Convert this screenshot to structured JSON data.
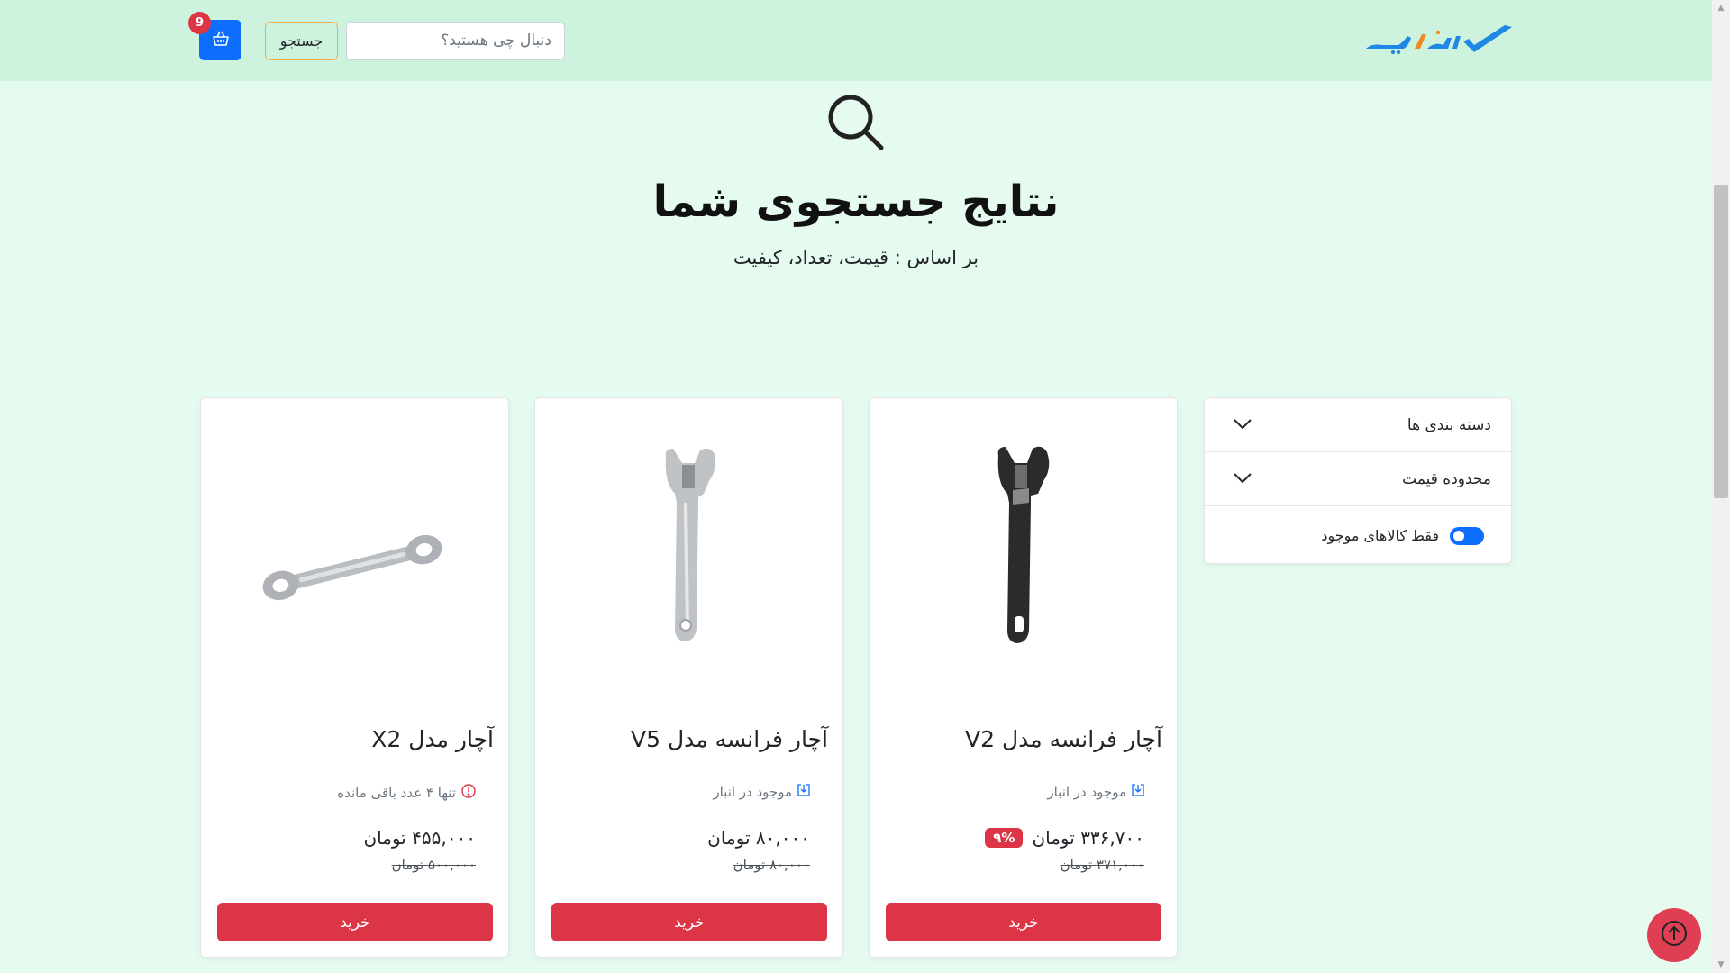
{
  "header": {
    "logo_text": "ابزارچه",
    "search_placeholder": "دنبال چی هستید؟",
    "search_button": "جستجو",
    "cart_count": "9"
  },
  "hero": {
    "title": "نتایج جستجوی شما",
    "subtitle": "بر اساس : قیمت، تعداد، کیفیت"
  },
  "filters": {
    "categories_label": "دسته بندی ها",
    "price_range_label": "محدوده قیمت",
    "in_stock_label": "فقط کالاهای موجود",
    "in_stock_enabled": true
  },
  "products": [
    {
      "title": "آچار فرانسه مدل V2",
      "stock": "موجود در انبار",
      "price": "۳۳۶,۷۰۰ تومان",
      "old_price": "۳۷۱,۰۰۰ تومان",
      "discount": "۹%",
      "buy_label": "خرید"
    },
    {
      "title": "آچار فرانسه مدل V5",
      "stock": "موجود در انبار",
      "price": "۸۰,۰۰۰ تومان",
      "old_price": "۸۰,۰۰۰ تومان",
      "buy_label": "خرید"
    },
    {
      "title": "آچار مدل X2",
      "stock": "تنها ۴ عدد باقی مانده",
      "price": "۴۵۵,۰۰۰ تومان",
      "old_price": "۵۰۰,۰۰۰ تومان",
      "buy_label": "خرید"
    }
  ],
  "colors": {
    "header_bg": "#cdf3df",
    "page_bg": "#e6fbef",
    "primary": "#0d6efd",
    "danger": "#dc3545",
    "search_btn_border": "#f0ad4e"
  },
  "icons": {
    "cart": "basket-icon",
    "hero": "search-icon",
    "chevron": "chevron-down-icon",
    "in_stock": "box-arrow-in-icon",
    "low_stock": "exclamation-circle-icon",
    "to_top": "arrow-up-circle-icon"
  }
}
